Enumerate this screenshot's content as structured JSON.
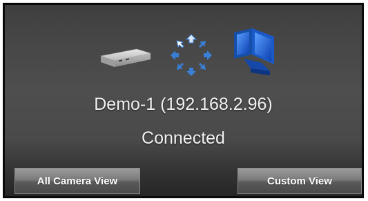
{
  "device": {
    "title": "Demo-1 (192.168.2.96)",
    "status": "Connected"
  },
  "icons": {
    "device": "network-device-icon",
    "sync": "connecting-arrows-icon",
    "monitor": "monitor-icon"
  },
  "buttons": {
    "all_camera_view": "All Camera View",
    "custom_view": "Custom View"
  },
  "colors": {
    "panel_dark": "#262626",
    "panel_mid": "#4e4e4e",
    "text": "#f2f2f2",
    "arrow_blue": "#3a7fd6",
    "monitor_blue": "#1e5fd0"
  }
}
